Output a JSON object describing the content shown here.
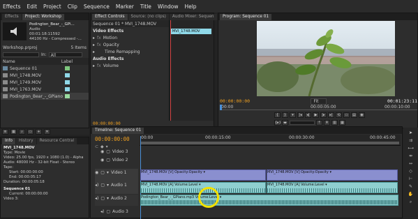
{
  "menu": [
    "Effects",
    "Edit",
    "Project",
    "Clip",
    "Sequence",
    "Marker",
    "Title",
    "Window",
    "Help"
  ],
  "project": {
    "tabs": [
      "Effects",
      "Project: Workshop"
    ],
    "preview_name": "Podington_Bear_-_GPi...",
    "preview_type": "Audio",
    "preview_dur": "00:01:18:11592",
    "preview_fmt": "44100 Hz - Compressed -...",
    "file": "Workshop.prproj",
    "items": "5 Items",
    "in_label": "In:",
    "in_value": "All",
    "col_name": "Name",
    "col_label": "Label",
    "rows": [
      {
        "name": "Sequence 01",
        "color": "#7ec87e"
      },
      {
        "name": "MVI_1748.MOV",
        "color": "#8fd8e8"
      },
      {
        "name": "MVI_1749.MOV",
        "color": "#8fd8e8"
      },
      {
        "name": "MVI_1763.MOV",
        "color": "#8fd8e8"
      },
      {
        "name": "Podington_Bear_-_GPiano",
        "color": "#9adba0"
      }
    ]
  },
  "info": {
    "tabs": [
      "Info",
      "History",
      "Resource Central"
    ],
    "name": "MVI_1748.MOV",
    "lines": [
      "Type: Movie",
      "Video: 25.00 fps, 1920 x 1080 (1.0) - Alpha",
      "Audio: 48000 Hz - 32-bit Float - Stereo",
      "Tape:",
      "Start: 00:00:00:00",
      "End: 00:00:05:17",
      "Duration: 00:00:05:18"
    ],
    "seq": "Sequence 01",
    "current": "Current: 00:00:00:00",
    "track": "Video 3:"
  },
  "effects": {
    "tabs": [
      "Effect Controls",
      "Source: (no clips)",
      "Audio Mixer: Sequen"
    ],
    "header": "Sequence 01 * MVI_1748.MOV",
    "clip": "MVI_1748.MOV",
    "rows": [
      "Video Effects",
      "Motion",
      "Opacity",
      "Time Remapping",
      "Audio Effects",
      "Volume"
    ],
    "tc": "00:00:00:00"
  },
  "program": {
    "tab": "Program: Sequence 01",
    "tc_in": "00:00:00:00",
    "fit": "Fit",
    "tc_dur": "00:01:23:11",
    "tick1": "00:00",
    "tick2": "00:00:05:00",
    "tick3": "00:00:10:00"
  },
  "timeline": {
    "tab": "Timeline: Sequence 01",
    "tc": "00:00:00:00",
    "ruler": [
      "00:00",
      "00:00:15:00",
      "00:00:30:00",
      "00:00:45:00"
    ],
    "tracks": [
      "Video 3",
      "Video 2",
      "Video 1",
      "Audio 1",
      "Audio 2",
      "Audio 3"
    ],
    "clips": {
      "v1a": "MVI_1748.MOV [V]  Opacity:Opacity ▾",
      "v1b": "MVI_1748.MOV [V]  Opacity:Opacity ▾",
      "a1a": "MVI_1748.MOV [A]  Volume:Level ▾",
      "a1b": "MVI_1748.MOV [A]  Volume:Level ▾",
      "a2": "Podington_Bear_-_GPiano.mp3  Volume:Level ▾"
    }
  },
  "colors": {
    "accent": "#f0a020",
    "video_clip": "#8a8fcf",
    "audio_clip": "#8fcfd0",
    "cursor_ring": "#f2e000"
  }
}
